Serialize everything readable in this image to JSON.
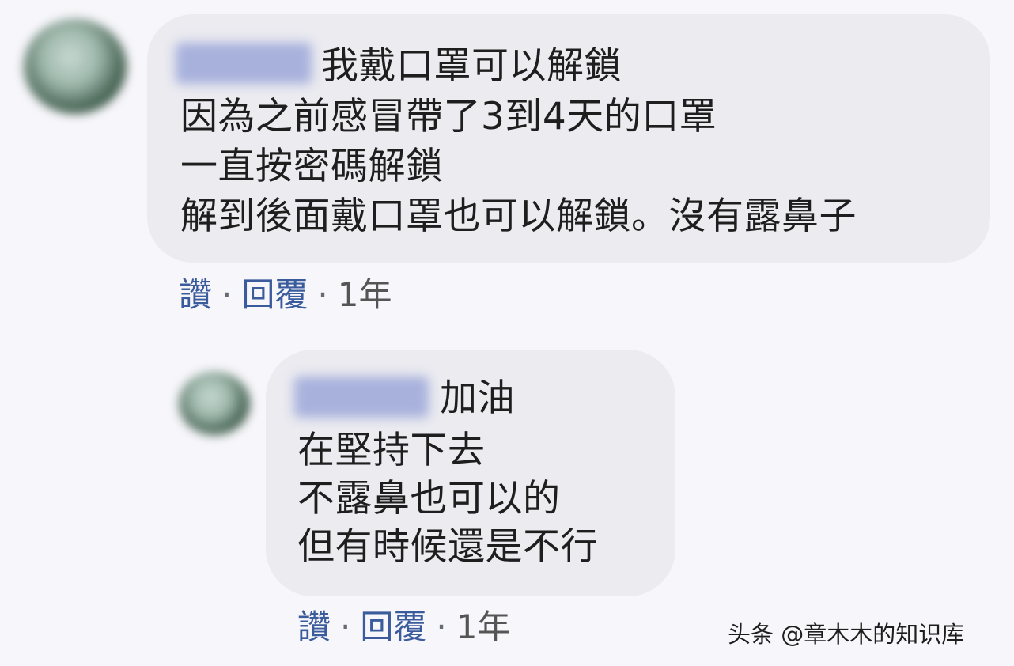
{
  "comments": [
    {
      "name_label": "",
      "lines": [
        "我戴口罩可以解鎖",
        "因為之前感冒帶了3到4天的口罩",
        "一直按密碼解鎖",
        "解到後面戴口罩也可以解鎖。沒有露鼻子"
      ],
      "like_label": "讚",
      "reply_label": "回覆",
      "separator": "·",
      "time_label": "1年"
    },
    {
      "name_label": "",
      "lines": [
        "加油",
        "在堅持下去",
        "不露鼻也可以的",
        "但有時候還是不行"
      ],
      "like_label": "讚",
      "reply_label": "回覆",
      "separator": "·",
      "time_label": "1年"
    }
  ],
  "watermark": "头条 @章木木的知识库"
}
